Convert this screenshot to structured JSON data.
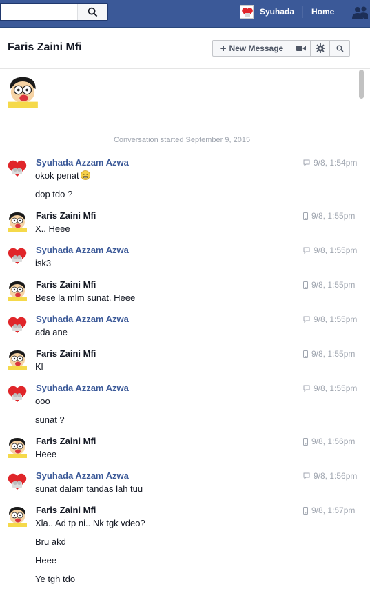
{
  "topbar": {
    "search_value": "",
    "user_name": "Syuhada",
    "home_label": "Home",
    "colors": {
      "bar": "#3b5998"
    }
  },
  "header": {
    "title": "Faris Zaini Mfi",
    "new_message_label": "New Message",
    "icons": [
      "plus-icon",
      "video-call-icon",
      "gear-icon",
      "search-icon"
    ]
  },
  "conversation": {
    "started_label": "Conversation started September 9, 2015",
    "messages": [
      {
        "sender": "Syuhada Azzam Azwa",
        "time": "9/8, 1:54pm",
        "lines": [
          "okok penat",
          "dop tdo ?"
        ]
      },
      {
        "sender": "Faris Zaini Mfi",
        "time": "9/8, 1:55pm",
        "lines": [
          "X.. Heee"
        ]
      },
      {
        "sender": "Syuhada Azzam Azwa",
        "time": "9/8, 1:55pm",
        "lines": [
          "isk3"
        ]
      },
      {
        "sender": "Faris Zaini Mfi",
        "time": "9/8, 1:55pm",
        "lines": [
          "Bese la mlm sunat. Heee"
        ]
      },
      {
        "sender": "Syuhada Azzam Azwa",
        "time": "9/8, 1:55pm",
        "lines": [
          "ada ane"
        ]
      },
      {
        "sender": "Faris Zaini Mfi",
        "time": "9/8, 1:55pm",
        "lines": [
          "Kl"
        ]
      },
      {
        "sender": "Syuhada Azzam Azwa",
        "time": "9/8, 1:55pm",
        "lines": [
          "ooo",
          "sunat ?"
        ]
      },
      {
        "sender": "Faris Zaini Mfi",
        "time": "9/8, 1:56pm",
        "lines": [
          "Heee"
        ]
      },
      {
        "sender": "Syuhada Azzam Azwa",
        "time": "9/8, 1:56pm",
        "lines": [
          "sunat dalam tandas lah tuu"
        ]
      },
      {
        "sender": "Faris Zaini Mfi",
        "time": "9/8, 1:57pm",
        "lines": [
          "Xla.. Ad tp ni.. Nk tgk vdeo?",
          "Bru akd",
          "Heee",
          "Ye tgh tdo"
        ]
      }
    ]
  }
}
